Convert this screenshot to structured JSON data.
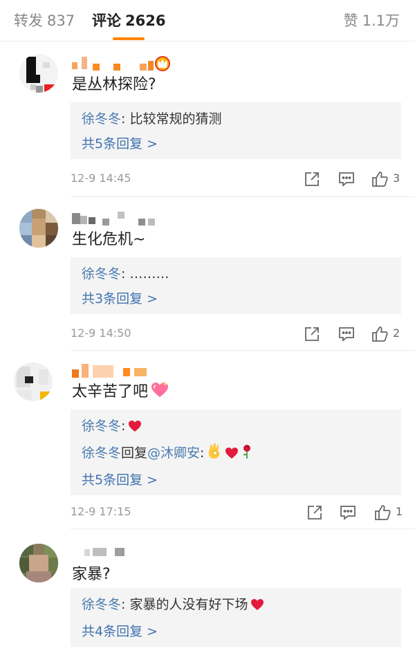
{
  "tabs": {
    "repost": {
      "label": "转发",
      "count": "837"
    },
    "comments": {
      "label": "评论",
      "count": "2626"
    },
    "likes": {
      "label": "赞",
      "count": "1.1万"
    }
  },
  "comments": [
    {
      "text": "是丛林探险?",
      "replies": [
        {
          "name": "徐冬冬",
          "text": ": 比较常规的猜测"
        }
      ],
      "more": "共5条回复 >",
      "time": "12-9 14:45",
      "likes": "3"
    },
    {
      "text": "生化危机~",
      "replies": [
        {
          "name": "徐冬冬",
          "text": ": ………"
        }
      ],
      "more": "共3条回复 >",
      "time": "12-9 14:50",
      "likes": "2"
    },
    {
      "text": "太辛苦了吧",
      "replies": [
        {
          "name": "徐冬冬",
          "text": ":"
        },
        {
          "name": "徐冬冬",
          "mid": "回复",
          "at": "@沐卿安",
          "text": ":"
        }
      ],
      "more": "共5条回复 >",
      "time": "12-9 17:15",
      "likes": "1"
    },
    {
      "text": "家暴?",
      "replies": [
        {
          "name": "徐冬冬",
          "text": ": 家暴的人没有好下场"
        }
      ],
      "more": "共4条回复 >"
    }
  ],
  "colors": {
    "accent": "#ff8200",
    "link": "#3f72af",
    "reply_bg": "#f4f4f4"
  },
  "icons": [
    "share-icon",
    "comment-icon",
    "like-icon",
    "crown-badge-icon",
    "heart-icon",
    "ok-hand-icon",
    "rose-icon",
    "sparkling-heart-icon"
  ]
}
